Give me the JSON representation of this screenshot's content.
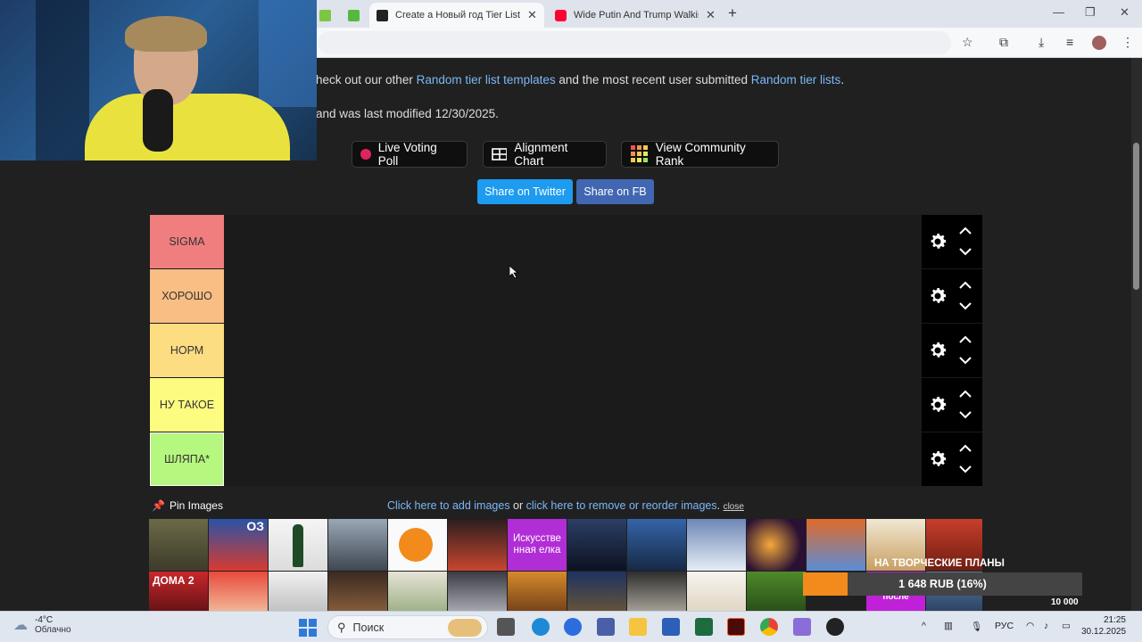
{
  "browser": {
    "tabs": [
      {
        "title": "Create a Новый год Tier List - T",
        "close": "✕"
      },
      {
        "title": "Wide Putin And Trump Walking",
        "close": "✕"
      }
    ],
    "new_tab": "+"
  },
  "page": {
    "line1": {
      "prefix": "heck out our other ",
      "link1": "Random tier list templates",
      "middle": " and the most recent user submitted ",
      "link2": "Random tier lists",
      "suffix": "."
    },
    "line2": "and was last modified 12/30/2025.",
    "buttons": {
      "poll": "Live Voting Poll",
      "alignment": "Alignment Chart",
      "community": "View Community Rank"
    },
    "share": {
      "twitter": "Share on Twitter",
      "fb": "Share on FB"
    },
    "tiers": [
      {
        "label": "SIGMA",
        "color": "#f07e7e"
      },
      {
        "label": "ХОРОШО",
        "color": "#f9be84"
      },
      {
        "label": "НОРМ",
        "color": "#fcdd82"
      },
      {
        "label": "НУ ТАКОЕ",
        "color": "#fdfb80"
      },
      {
        "label": "ШЛЯПА*",
        "color": "#b6f77f"
      }
    ],
    "pin_images": "Pin Images",
    "add_images": {
      "link1": "Click here to add images",
      "or": " or ",
      "link2": "click here to remove or reorder images",
      "dot": ". ",
      "close": "close"
    },
    "gallery_text": {
      "art": "Искусстве нная елка",
      "oz": "ОЗ",
      "doma": "ДОМА 2",
      "posle": "после"
    }
  },
  "donation": {
    "title": "НА ТВОРЧЕСКИЕ ПЛАНЫ",
    "amount": "1 648 RUB (16%)",
    "goal": "10 000",
    "progress_percent": 16
  },
  "taskbar": {
    "temp": "-4°C",
    "weather": "Облачно",
    "search": "Поиск",
    "lang": "РУС",
    "time": "21:25",
    "date": "30.12.2025"
  }
}
